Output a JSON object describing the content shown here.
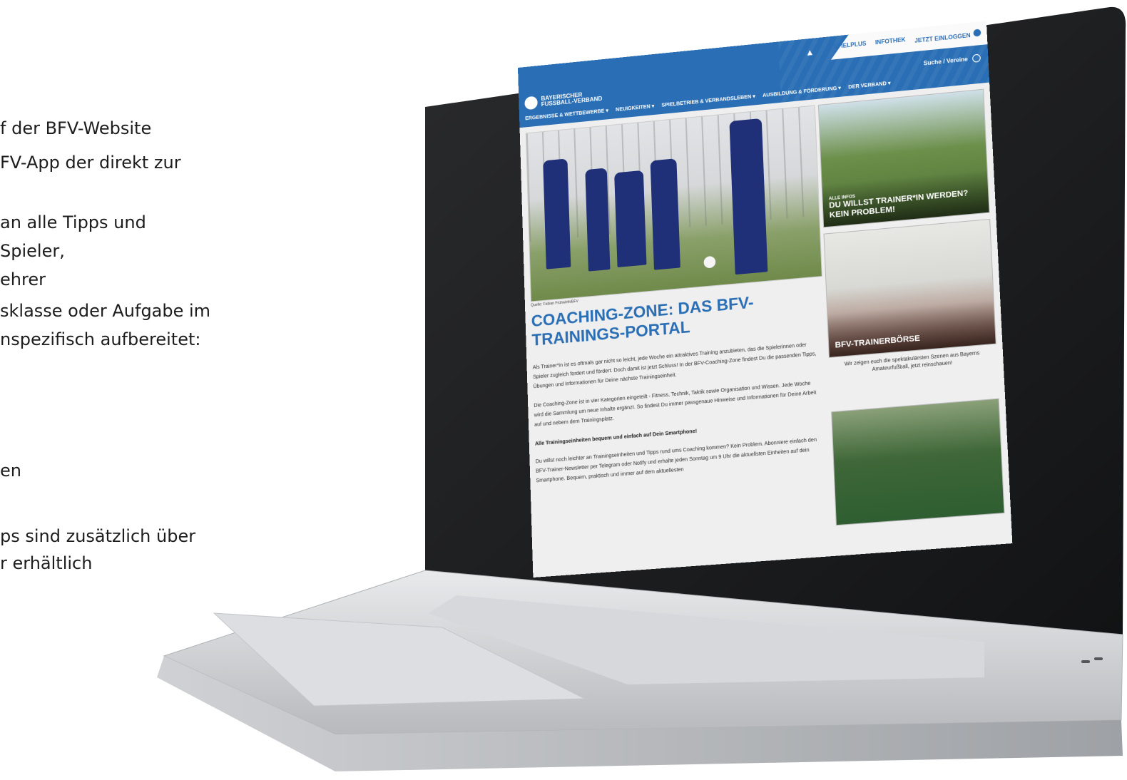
{
  "slide_text": [
    "f der BFV-Website",
    "FV-App der direkt zur",
    "an alle Tipps und",
    "Spieler,",
    "ehrer",
    "sklasse oder Aufgabe im",
    "nspezifisch aufbereitet:",
    "en",
    "ps sind zusätzlich über",
    "r erhältlich"
  ],
  "site": {
    "top_links": [
      "SPIELPLUS",
      "INFOTHEK",
      "JETZT EINLOGGEN"
    ],
    "logo": {
      "line1": "BAYERISCHER",
      "line2": "FUSSBALL-VERBAND"
    },
    "search_label": "Suche / Vereine",
    "main_nav": [
      "ERGEBNISSE & WETTBEWERBE ▾",
      "NEUIGKEITEN ▾",
      "SPIELBETRIEB & VERBANDSLEBEN ▾",
      "AUSBILDUNG & FÖRDERUNG ▾",
      "DER VERBAND ▾"
    ],
    "photo_credit": "Quelle: Fabian Frühwirth/BFV",
    "headline": "COACHING-ZONE: DAS BFV-TRAININGS-PORTAL",
    "paragraphs": {
      "p1": "Als Trainer*in ist es oftmals gar nicht so leicht, jede Woche ein attraktives Training anzubieten, das die Spielerinnen oder Spieler zugleich fordert und fördert. Doch damit ist jetzt Schluss! In der BFV-Coaching-Zone findest Du die passenden Tipps, Übungen und Informationen für Deine nächste Trainingseinheit.",
      "p2": "Die Coaching-Zone ist in vier Kategorien eingeteilt - Fitness, Technik, Taktik sowie Organisation und Wissen. Jede Woche wird die Sammlung um neue Inhalte ergänzt. So findest Du immer passgenaue Hinweise und Informationen für Deine Arbeit auf und nebem dem Trainingsplatz.",
      "p3": "Alle Trainingseinheiten bequem und einfach auf Dein Smartphone!",
      "p4": "Du willst noch leichter an Trainingseinheiten und Tipps rund ums Coaching kommen? Kein Problem. Abonniere einfach den BFV-Trainer-Newsletter per Telegram oder Notify und erhalte jeden Sonntag um 9 Uhr die aktuellsten Einheiten auf dein Smartphone. Bequem, praktisch und immer auf dem aktuellesten"
    },
    "cards": [
      {
        "kicker": "ALLE INFOS",
        "title": "DU WILLST TRAINER*IN WERDEN? KEIN PROBLEM!"
      },
      {
        "kicker": "",
        "title": "BFV-TRAINERBÖRSE"
      }
    ],
    "side_note": "Wir zeigen euch die spektakulärsten Szenen aus Bayerns Amateurfußball, jetzt reinschauen!"
  }
}
